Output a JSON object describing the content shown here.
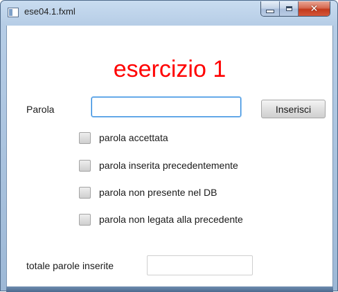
{
  "window": {
    "title": "ese04.1.fxml",
    "caption": {
      "minimize": "minimize",
      "maximize": "maximize",
      "close": "close"
    }
  },
  "form": {
    "heading": "esercizio 1",
    "parola_label": "Parola",
    "parola_value": "",
    "inserisci_label": "Inserisci",
    "checkboxes": [
      {
        "label": "parola accettata",
        "checked": false
      },
      {
        "label": "parola inserita precedentemente",
        "checked": false
      },
      {
        "label": "parola non presente nel DB",
        "checked": false
      },
      {
        "label": "parola non legata alla precedente",
        "checked": false
      }
    ],
    "totale_label": "totale parole inserite",
    "totale_value": ""
  },
  "colors": {
    "heading": "#ff0000",
    "focus_border": "#2f89de",
    "close_button": "#c3391c"
  }
}
